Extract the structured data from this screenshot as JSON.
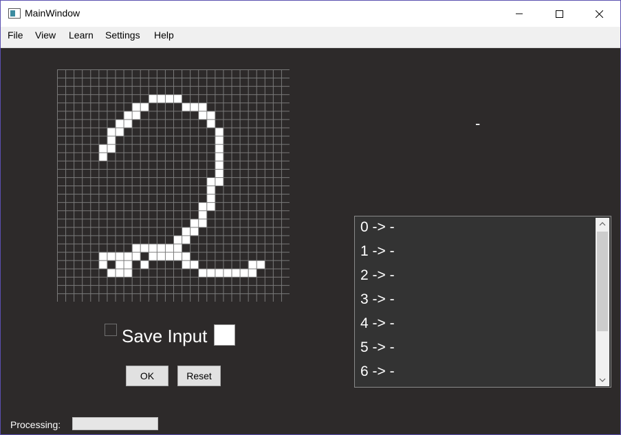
{
  "window": {
    "title": "MainWindow"
  },
  "menu": {
    "file": "File",
    "view": "View",
    "learn": "Learn",
    "settings": "Settings",
    "help": "Help"
  },
  "drawing_grid": {
    "rows": 28,
    "cols": 28,
    "filled": [
      [
        3,
        11
      ],
      [
        3,
        12
      ],
      [
        3,
        13
      ],
      [
        3,
        14
      ],
      [
        4,
        9
      ],
      [
        4,
        10
      ],
      [
        4,
        15
      ],
      [
        4,
        16
      ],
      [
        4,
        17
      ],
      [
        5,
        8
      ],
      [
        5,
        9
      ],
      [
        5,
        17
      ],
      [
        5,
        18
      ],
      [
        6,
        7
      ],
      [
        6,
        8
      ],
      [
        6,
        18
      ],
      [
        7,
        6
      ],
      [
        7,
        7
      ],
      [
        7,
        19
      ],
      [
        8,
        6
      ],
      [
        8,
        19
      ],
      [
        9,
        5
      ],
      [
        9,
        6
      ],
      [
        9,
        19
      ],
      [
        10,
        5
      ],
      [
        10,
        19
      ],
      [
        11,
        19
      ],
      [
        12,
        19
      ],
      [
        13,
        18
      ],
      [
        13,
        19
      ],
      [
        14,
        18
      ],
      [
        15,
        18
      ],
      [
        16,
        17
      ],
      [
        16,
        18
      ],
      [
        17,
        17
      ],
      [
        18,
        16
      ],
      [
        18,
        17
      ],
      [
        19,
        15
      ],
      [
        19,
        16
      ],
      [
        20,
        14
      ],
      [
        20,
        15
      ],
      [
        21,
        9
      ],
      [
        21,
        10
      ],
      [
        21,
        11
      ],
      [
        21,
        12
      ],
      [
        21,
        13
      ],
      [
        21,
        14
      ],
      [
        22,
        5
      ],
      [
        22,
        6
      ],
      [
        22,
        7
      ],
      [
        22,
        8
      ],
      [
        22,
        9
      ],
      [
        22,
        11
      ],
      [
        22,
        12
      ],
      [
        22,
        13
      ],
      [
        22,
        14
      ],
      [
        22,
        15
      ],
      [
        23,
        5
      ],
      [
        23,
        7
      ],
      [
        23,
        8
      ],
      [
        23,
        10
      ],
      [
        23,
        15
      ],
      [
        23,
        16
      ],
      [
        23,
        23
      ],
      [
        23,
        24
      ],
      [
        24,
        6
      ],
      [
        24,
        7
      ],
      [
        24,
        8
      ],
      [
        24,
        17
      ],
      [
        24,
        18
      ],
      [
        24,
        19
      ],
      [
        24,
        20
      ],
      [
        24,
        21
      ],
      [
        24,
        22
      ],
      [
        24,
        23
      ]
    ]
  },
  "save_input": {
    "label": "Save Input",
    "checked": false
  },
  "buttons": {
    "ok": "OK",
    "reset": "Reset"
  },
  "result": {
    "value": "-"
  },
  "scores": [
    {
      "digit": "0",
      "arrow": "->",
      "value": "-"
    },
    {
      "digit": "1",
      "arrow": "->",
      "value": "-"
    },
    {
      "digit": "2",
      "arrow": "->",
      "value": "-"
    },
    {
      "digit": "3",
      "arrow": "->",
      "value": "-"
    },
    {
      "digit": "4",
      "arrow": "->",
      "value": "-"
    },
    {
      "digit": "5",
      "arrow": "->",
      "value": "-"
    },
    {
      "digit": "6",
      "arrow": "->",
      "value": "-"
    }
  ],
  "status": {
    "processing_label": "Processing:",
    "progress_fraction": 0
  },
  "colors": {
    "background": "#2d2a2a",
    "grid_line": "#7a7a7a",
    "cell_empty": "#2d2a2a",
    "cell_filled": "#ffffff",
    "progress_fill": "#06b025"
  }
}
